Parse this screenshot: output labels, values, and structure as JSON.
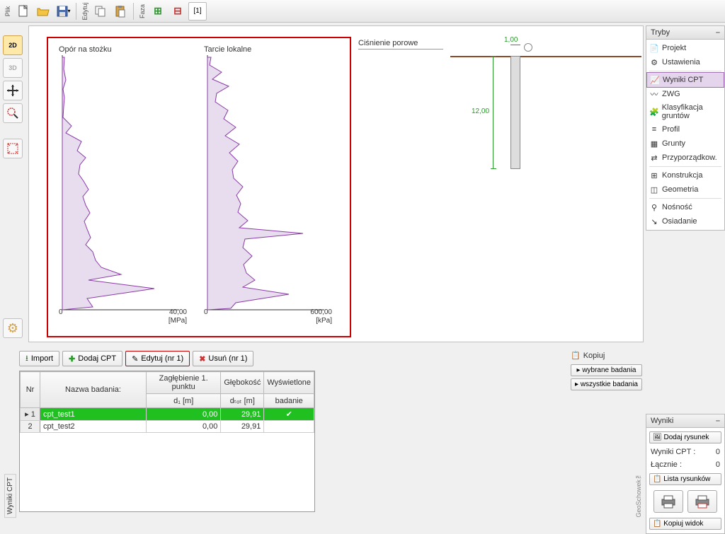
{
  "toolbar": {
    "file_label": "Plik",
    "edit_label": "Edytuj",
    "phase_label": "Faza",
    "phase_tab": "[1]"
  },
  "left_tools": {
    "view2d": "2D",
    "view3d": "3D"
  },
  "charts": {
    "title1": "Opór na stożku",
    "title2": "Tarcie lokalne",
    "title3": "Ciśnienie porowe",
    "x1_min": "0",
    "x1_max": "40,00",
    "unit1": "[MPa]",
    "x2_min": "0",
    "x2_max": "600,00",
    "unit2": "[kPa]"
  },
  "cross_section": {
    "depth": "12,00",
    "width": "1,00"
  },
  "modes_panel": {
    "title": "Tryby",
    "items": [
      {
        "icon": "📄",
        "label": "Projekt"
      },
      {
        "icon": "⚙",
        "label": "Ustawienia"
      },
      {
        "icon": "📈",
        "label": "Wyniki CPT",
        "active": true
      },
      {
        "icon": "〰",
        "label": "ZWG"
      },
      {
        "icon": "🧩",
        "label": "Klasyfikacja gruntów"
      },
      {
        "icon": "≡",
        "label": "Profil"
      },
      {
        "icon": "▦",
        "label": "Grunty"
      },
      {
        "icon": "⇄",
        "label": "Przyporządkow."
      },
      {
        "icon": "⊞",
        "label": "Konstrukcja"
      },
      {
        "icon": "◫",
        "label": "Geometria"
      },
      {
        "icon": "⚲",
        "label": "Nośność"
      },
      {
        "icon": "↘",
        "label": "Osiadanie"
      }
    ]
  },
  "bottom": {
    "side_tab": "Wyniki CPT",
    "import_label": "Import",
    "add_label": "Dodaj CPT",
    "edit_label": "Edytuj (nr 1)",
    "delete_label": "Usuń (nr 1)",
    "headers": {
      "nr": "Nr",
      "name": "Nazwa badania:",
      "depth1_a": "Zagłębienie 1. punktu",
      "depth1_b": "d₁ [m]",
      "total_a": "Głębokość",
      "total_b": "dₜₒₜ [m]",
      "displayed_a": "Wyświetlone",
      "displayed_b": "badanie"
    },
    "rows": [
      {
        "nr": "1",
        "name": "cpt_test1",
        "d1": "0,00",
        "dtot": "29,91",
        "disp": "✔",
        "selected": true
      },
      {
        "nr": "2",
        "name": "cpt_test2",
        "d1": "0,00",
        "dtot": "29,91",
        "disp": "",
        "selected": false
      }
    ],
    "geoschowek": "GeoSchowek™"
  },
  "copy_panel": {
    "title": "Kopiuj",
    "btn1": "wybrane badania",
    "btn2": "wszystkie badania"
  },
  "results_panel": {
    "title": "Wyniki",
    "add_drawing": "Dodaj rysunek",
    "row1_label": "Wyniki CPT :",
    "row1_val": "0",
    "row2_label": "Łącznie :",
    "row2_val": "0",
    "list_label": "Lista rysunków",
    "copy_view": "Kopiuj widok"
  },
  "chart_data": [
    {
      "type": "line",
      "title": "Opór na stożku",
      "xlabel": "[MPa]",
      "xlim": [
        0,
        40
      ],
      "ylim_depth_m": [
        0,
        29.91
      ],
      "series": [
        {
          "name": "qc",
          "depth_m": [
            0,
            2,
            4,
            5,
            6,
            7,
            8,
            10,
            12,
            13,
            14,
            15,
            16,
            18,
            20,
            22,
            24,
            25,
            26,
            27,
            28,
            29.5
          ],
          "values_MPa": [
            1,
            1,
            2,
            1,
            0.5,
            2,
            3,
            6,
            7,
            6,
            5,
            6,
            8,
            8,
            8,
            9,
            10,
            11,
            18,
            8,
            30,
            10
          ]
        }
      ]
    },
    {
      "type": "line",
      "title": "Tarcie lokalne",
      "xlabel": "[kPa]",
      "xlim": [
        0,
        600
      ],
      "ylim_depth_m": [
        0,
        29.91
      ],
      "series": [
        {
          "name": "fs",
          "depth_m": [
            0,
            1,
            2,
            3,
            4,
            5,
            6,
            7,
            8,
            10,
            12,
            14,
            16,
            18,
            20,
            22,
            23,
            24,
            26,
            27,
            28,
            29.5
          ],
          "values_kPa": [
            10,
            5,
            40,
            20,
            60,
            30,
            25,
            60,
            80,
            90,
            100,
            90,
            95,
            110,
            120,
            150,
            450,
            120,
            150,
            140,
            350,
            90
          ]
        }
      ]
    }
  ]
}
